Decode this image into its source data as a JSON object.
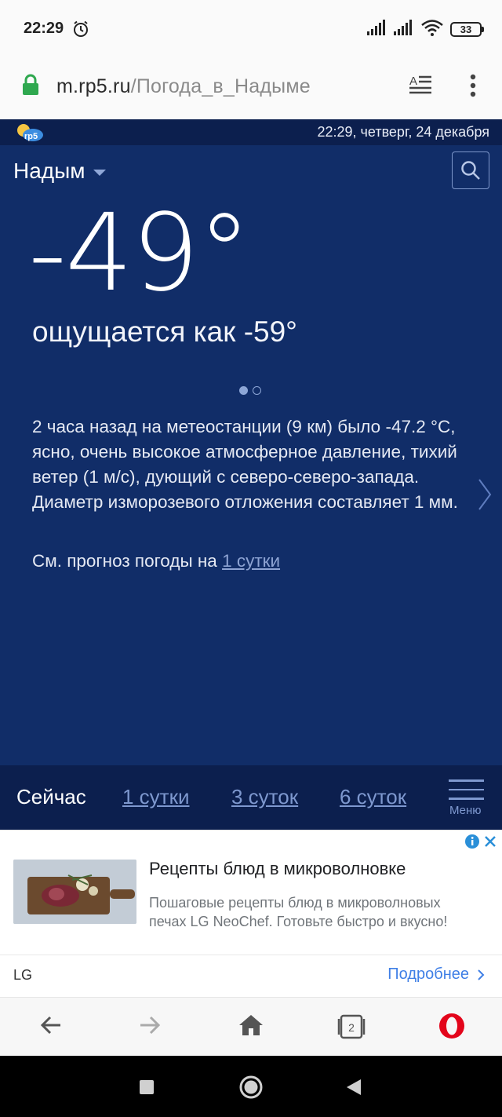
{
  "status_bar": {
    "time": "22:29",
    "battery": "33",
    "icons": [
      "alarm-icon",
      "signal-icon",
      "signal-icon",
      "wifi-icon",
      "battery-icon"
    ]
  },
  "browser": {
    "url_host": "m.rp5.ru",
    "url_path": "/Погода_в_Надыме",
    "tabs_count": "2"
  },
  "header": {
    "logo": "rp5",
    "datetime": "22:29, четверг, 24 декабря"
  },
  "weather": {
    "city": "Надым",
    "temperature": "-49°",
    "feels_like": "ощущается как -59°",
    "description": "2 часа назад на метеостанции (9 км) было -47.2 °С, ясно, очень высокое атмосферное давление, тихий ветер (1 м/с), дующий с северо-северо-запада. Диаметр изморозевого отложения составляет 1 мм.",
    "forecast_prefix": "См. прогноз погоды на ",
    "forecast_link": "1 сутки",
    "carousel_pages": 2,
    "carousel_active": 0
  },
  "tabs": {
    "now": "Сейчас",
    "day1": "1 сутки",
    "day3": "3 суток",
    "day6": "6 суток",
    "menu": "Меню"
  },
  "ad": {
    "title": "Рецепты блюд в микроволновке",
    "body": "Пошаговые рецепты блюд в микроволновых печах LG NeoChef. Готовьте быстро и вкусно!",
    "brand": "LG",
    "cta": "Подробнее"
  },
  "colors": {
    "main_bg": "#112d68",
    "header_bg": "#0c1f4e",
    "link": "#7e98cf",
    "ad_cta": "#3f7fe6",
    "opera_red": "#e3051b"
  }
}
